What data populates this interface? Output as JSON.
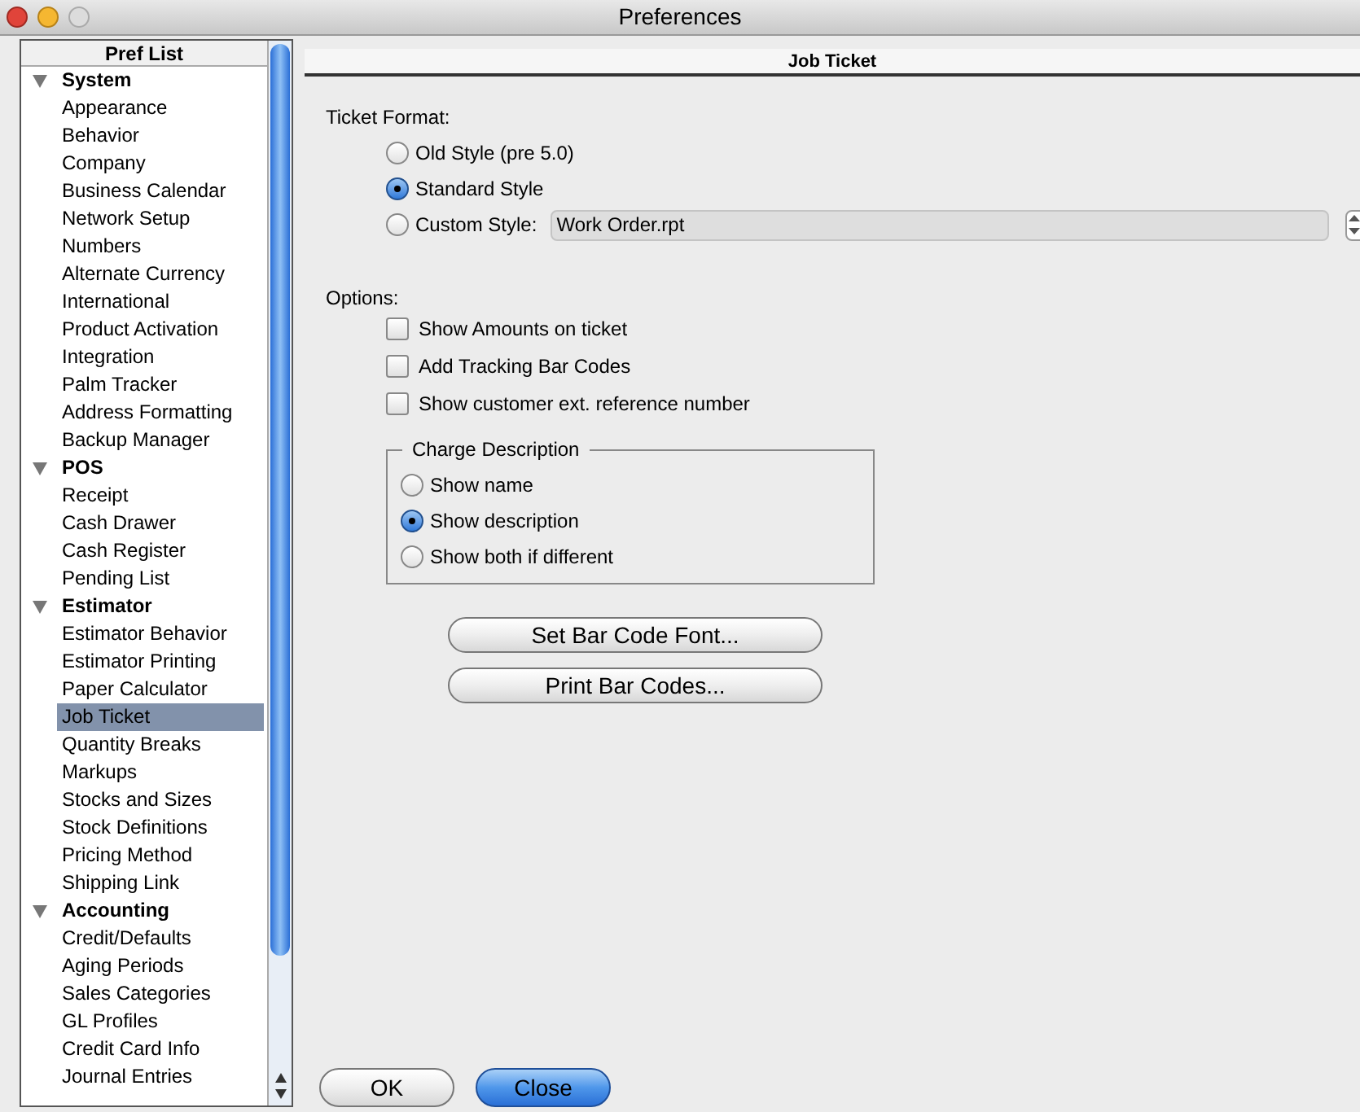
{
  "window": {
    "title": "Preferences"
  },
  "sidebar": {
    "header": "Pref List",
    "groups": [
      {
        "label": "System",
        "expanded": true,
        "children": [
          {
            "label": "Appearance",
            "selected": false
          },
          {
            "label": "Behavior",
            "selected": false
          },
          {
            "label": "Company",
            "selected": false
          },
          {
            "label": "Business Calendar",
            "selected": false
          },
          {
            "label": "Network Setup",
            "selected": false
          },
          {
            "label": "Numbers",
            "selected": false
          },
          {
            "label": "Alternate Currency",
            "selected": false
          },
          {
            "label": "International",
            "selected": false
          },
          {
            "label": "Product Activation",
            "selected": false
          },
          {
            "label": "Integration",
            "selected": false
          },
          {
            "label": "Palm Tracker",
            "selected": false
          },
          {
            "label": "Address Formatting",
            "selected": false
          },
          {
            "label": "Backup Manager",
            "selected": false
          }
        ]
      },
      {
        "label": "POS",
        "expanded": true,
        "children": [
          {
            "label": "Receipt",
            "selected": false
          },
          {
            "label": "Cash Drawer",
            "selected": false
          },
          {
            "label": "Cash Register",
            "selected": false
          },
          {
            "label": "Pending List",
            "selected": false
          }
        ]
      },
      {
        "label": "Estimator",
        "expanded": true,
        "children": [
          {
            "label": "Estimator Behavior",
            "selected": false
          },
          {
            "label": "Estimator Printing",
            "selected": false
          },
          {
            "label": "Paper Calculator",
            "selected": false
          },
          {
            "label": "Job Ticket",
            "selected": true
          },
          {
            "label": "Quantity Breaks",
            "selected": false
          },
          {
            "label": "Markups",
            "selected": false
          },
          {
            "label": "Stocks and Sizes",
            "selected": false
          },
          {
            "label": "Stock Definitions",
            "selected": false
          },
          {
            "label": "Pricing Method",
            "selected": false
          },
          {
            "label": "Shipping Link",
            "selected": false
          }
        ]
      },
      {
        "label": "Accounting",
        "expanded": true,
        "children": [
          {
            "label": "Credit/Defaults",
            "selected": false
          },
          {
            "label": "Aging Periods",
            "selected": false
          },
          {
            "label": "Sales Categories",
            "selected": false
          },
          {
            "label": "GL Profiles",
            "selected": false
          },
          {
            "label": "Credit Card Info",
            "selected": false
          },
          {
            "label": "Journal Entries",
            "selected": false
          }
        ]
      }
    ]
  },
  "panel": {
    "header": "Job Ticket",
    "ticket_format": {
      "label": "Ticket Format:",
      "options": [
        {
          "label": "Old Style (pre 5.0)",
          "selected": false
        },
        {
          "label": "Standard Style",
          "selected": true
        },
        {
          "label": "Custom Style:",
          "selected": false,
          "value": "Work Order.rpt"
        }
      ]
    },
    "options": {
      "label": "Options:",
      "items": [
        {
          "label": "Show Amounts on ticket",
          "checked": false
        },
        {
          "label": "Add Tracking Bar Codes",
          "checked": false
        },
        {
          "label": "Show customer ext. reference number",
          "checked": false
        }
      ]
    },
    "charge_description": {
      "label": "Charge Description",
      "options": [
        {
          "label": "Show name",
          "selected": false
        },
        {
          "label": "Show description",
          "selected": true
        },
        {
          "label": "Show both if different",
          "selected": false
        }
      ]
    },
    "buttons": [
      "Set Bar Code Font...",
      "Print Bar Codes..."
    ]
  },
  "footer_buttons": [
    {
      "label": "OK",
      "default": false
    },
    {
      "label": "Close",
      "default": true
    }
  ]
}
